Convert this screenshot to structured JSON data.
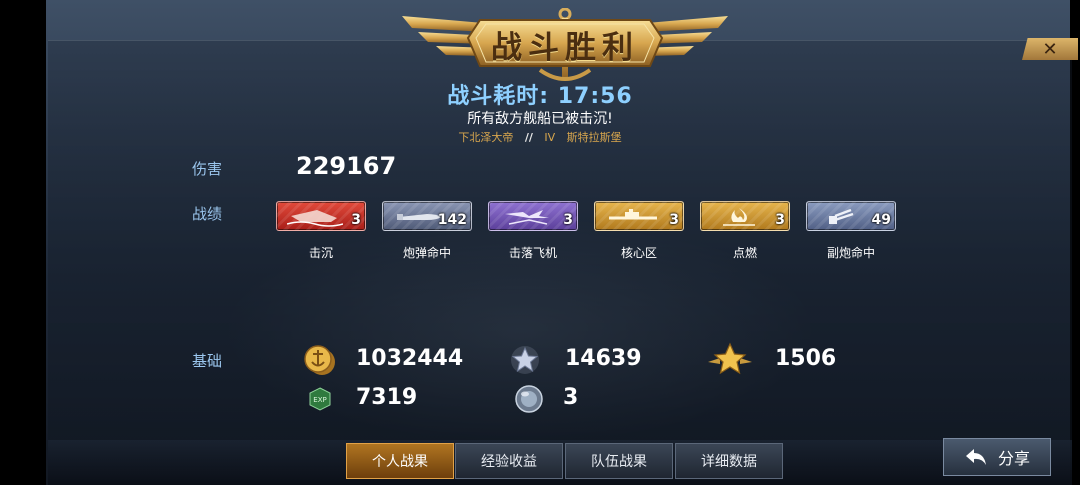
{
  "banner": {
    "title": "战斗胜利"
  },
  "close": {
    "icon": "close-icon",
    "glyph": "✕"
  },
  "battle": {
    "time_label": "战斗耗时: 17:56",
    "message": "所有敌方舰船已被击沉!",
    "ship_name": "下北泽大帝",
    "tier": "IV",
    "ship_class": "斯特拉斯堡"
  },
  "damage": {
    "label": "伤害",
    "value": "229167"
  },
  "achievements": {
    "label": "战绩",
    "items": [
      {
        "icon": "sink-icon",
        "count": "3",
        "label": "击沉",
        "color": "#c83228"
      },
      {
        "icon": "shell-hit-icon",
        "count": "142",
        "label": "炮弹命中",
        "color": "#6a7594"
      },
      {
        "icon": "planes-shot-down-icon",
        "count": "3",
        "label": "击落飞机",
        "color": "#7455b4"
      },
      {
        "icon": "citadel-hit-icon",
        "count": "3",
        "label": "核心区",
        "color": "#ce9a33"
      },
      {
        "icon": "fire-icon",
        "count": "3",
        "label": "点燃",
        "color": "#ce9a33"
      },
      {
        "icon": "secondary-hit-icon",
        "count": "49",
        "label": "副炮命中",
        "color": "#6b7ba2"
      }
    ]
  },
  "base": {
    "label": "基础",
    "credits": {
      "icon": "credits-coin-icon",
      "value": "1032444"
    },
    "exp": {
      "icon": "exp-icon",
      "value": "7319"
    },
    "captain_exp": {
      "icon": "silver-star-icon",
      "value": "14639"
    },
    "free_exp": {
      "icon": "gold-star-icon",
      "value": "1506"
    },
    "extra": {
      "icon": "globe-orb-icon",
      "value": "3"
    }
  },
  "tabs": [
    {
      "label": "个人战果",
      "active": true
    },
    {
      "label": "经验收益",
      "active": false
    },
    {
      "label": "队伍战果",
      "active": false
    },
    {
      "label": "详细数据",
      "active": false
    }
  ],
  "share": {
    "label": "分享",
    "icon": "back-arrow-icon"
  }
}
